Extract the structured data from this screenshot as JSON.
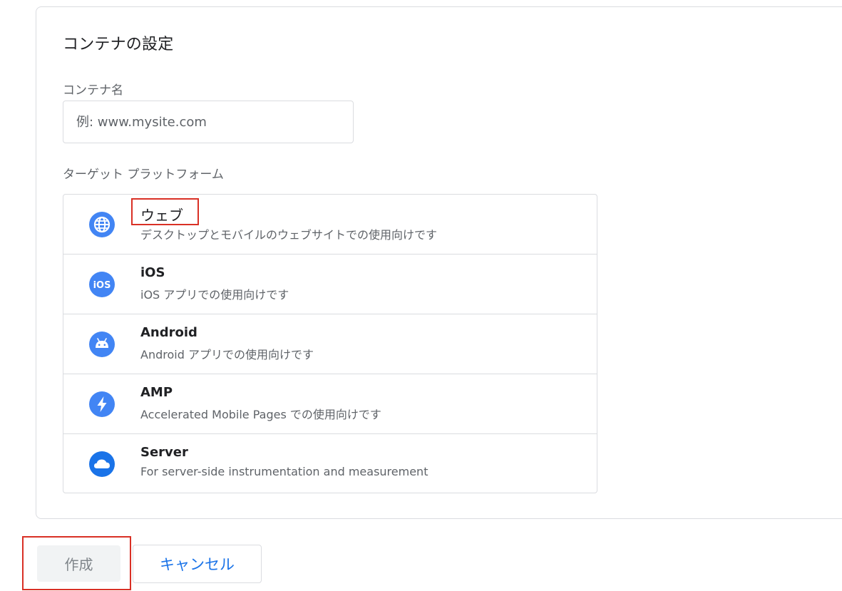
{
  "card": {
    "title": "コンテナの設定",
    "name_label": "コンテナ名",
    "name_placeholder": "例: www.mysite.com",
    "name_value": "",
    "platform_label": "ターゲット プラットフォーム"
  },
  "platforms": [
    {
      "title": "ウェブ",
      "desc": "デスクトップとモバイルのウェブサイトでの使用向けです",
      "icon": "globe-icon"
    },
    {
      "title": "iOS",
      "desc": "iOS アプリでの使用向けです",
      "icon": "ios-icon",
      "icon_text": "iOS"
    },
    {
      "title": "Android",
      "desc": "Android アプリでの使用向けです",
      "icon": "android-icon"
    },
    {
      "title": "AMP",
      "desc": "Accelerated Mobile Pages での使用向けです",
      "icon": "lightning-bolt-icon"
    },
    {
      "title": "Server",
      "desc": "For server-side instrumentation and measurement",
      "icon": "cloud-icon"
    }
  ],
  "actions": {
    "create_label": "作成",
    "cancel_label": "キャンセル"
  },
  "colors": {
    "icon_blue": "#4285f4",
    "link_blue": "#1a73e8",
    "highlight_red": "#d93025"
  }
}
